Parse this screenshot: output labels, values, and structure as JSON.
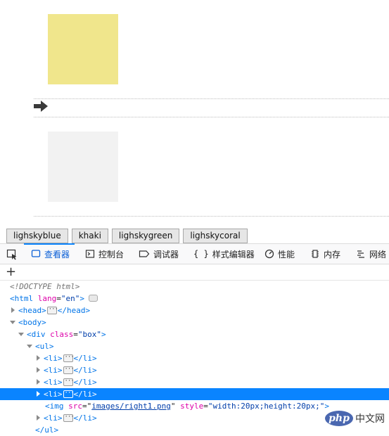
{
  "page": {
    "squares": [
      {
        "color": "#f0e68c"
      },
      {
        "color": "#f2f2f2"
      }
    ],
    "arrow_icon": "right-arrow-icon"
  },
  "buttons": [
    {
      "label": "lighskyblue"
    },
    {
      "label": "khaki"
    },
    {
      "label": "lighskygreen"
    },
    {
      "label": "lighskycoral"
    }
  ],
  "devtools": {
    "tabs": [
      {
        "label": "查看器",
        "icon": "inspector-icon",
        "active": true
      },
      {
        "label": "控制台",
        "icon": "console-icon"
      },
      {
        "label": "调试器",
        "icon": "debugger-icon"
      },
      {
        "label": "样式编辑器",
        "icon": "style-editor-icon"
      },
      {
        "label": "性能",
        "icon": "performance-icon"
      },
      {
        "label": "内存",
        "icon": "memory-icon"
      },
      {
        "label": "网络",
        "icon": "network-icon"
      }
    ],
    "add_node_label": "+",
    "tree": {
      "doctype": "<!DOCTYPE html>",
      "html_open": "<html",
      "html_lang_attr": "lang",
      "html_lang_val": "\"en\"",
      "html_close": ">",
      "head_open": "<head>",
      "head_close": "</head>",
      "body_open": "<body>",
      "div_open": "<div",
      "div_class_attr": "class",
      "div_class_val": "\"box\"",
      "div_close": ">",
      "ul_open": "<ul>",
      "li_open": "<li>",
      "li_close": "</li>",
      "img_open": "<img",
      "img_src_attr": "src",
      "img_src_val": "images/right1.png",
      "img_style_attr": "style",
      "img_style_val": "\"width:20px;height:20px;\"",
      "img_close": ">",
      "ul_close": "</ul>"
    }
  },
  "watermark": {
    "logo": "php",
    "site": "中文网"
  }
}
